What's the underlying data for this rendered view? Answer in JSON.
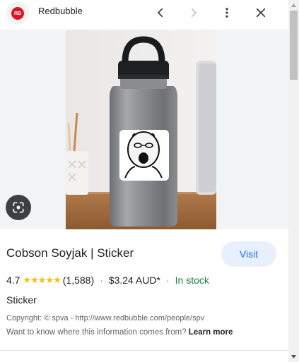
{
  "header": {
    "site_name": "Redbubble",
    "logo_icon": "redbubble-logo-icon",
    "logo_text": "RB",
    "back_icon": "chevron-left-icon",
    "forward_icon": "chevron-right-icon",
    "menu_icon": "more-vert-icon",
    "close_icon": "close-icon"
  },
  "image": {
    "description_icon": "google-lens-icon"
  },
  "product": {
    "title": "Cobson Soyjak | Sticker",
    "visit_label": "Visit",
    "rating": "4.7",
    "stars": "★★★★★",
    "review_count": "(1,588)",
    "price": "$3.24 AUD*",
    "stock": "In stock",
    "type": "Sticker",
    "copyright": "Copyright: © spva - http://www.redbubble.com/people/spv",
    "info_prefix": "Want to know where this information comes from?",
    "learn_more": "Learn more"
  },
  "colors": {
    "accent": "#1a73e8",
    "stock_green": "#188038",
    "star_yellow": "#fbbc04"
  }
}
